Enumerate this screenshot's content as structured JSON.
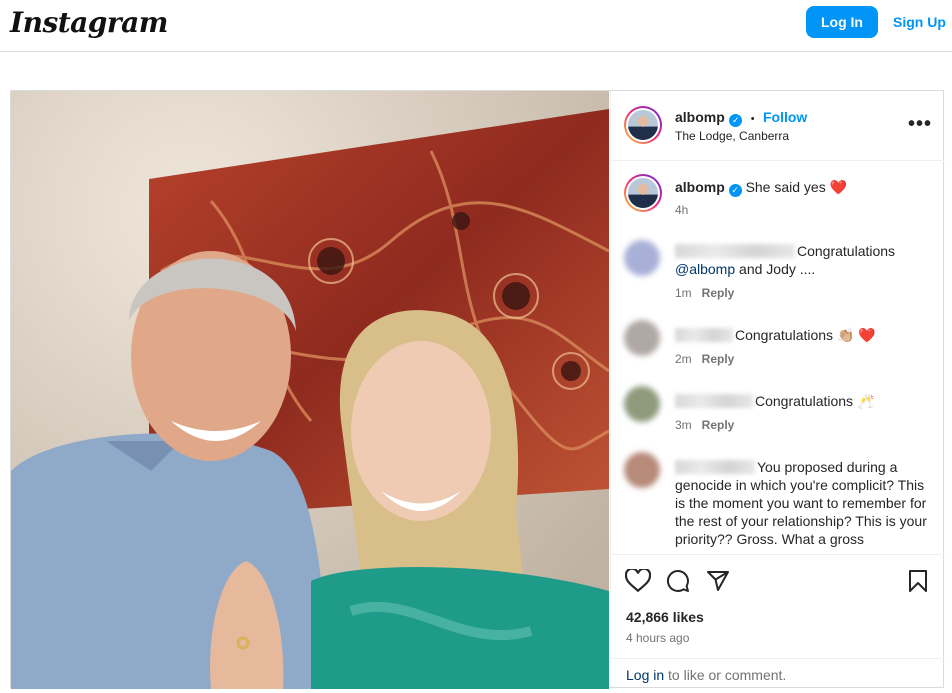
{
  "header": {
    "logo": "Instagram",
    "login_label": "Log In",
    "signup_label": "Sign Up"
  },
  "post": {
    "username": "albomp",
    "follow_label": "Follow",
    "separator": "•",
    "location": "The Lodge, Canberra",
    "more_label": "•••",
    "caption": {
      "username": "albomp",
      "text": "She said yes",
      "emoji": "❤️",
      "time": "4h"
    },
    "comments": [
      {
        "text": "Congratulations",
        "mention": "@albomp",
        "text_after": "and Jody ....",
        "time": "1m",
        "reply_label": "Reply"
      },
      {
        "text": "Congratulations 👏🏼 ❤️",
        "time": "2m",
        "reply_label": "Reply"
      },
      {
        "text": "Congratulations 🥂",
        "time": "3m",
        "reply_label": "Reply"
      },
      {
        "text": "You proposed during a genocide in which you're complicit? This is the moment you want to remember for the rest of your relationship? This is your priority?? Gross. What a gross"
      }
    ],
    "likes": "42,866 likes",
    "posted_ago": "4 hours ago",
    "login_prompt": {
      "link": "Log in",
      "text": "to like or comment."
    }
  },
  "icons": [
    "heart-icon",
    "comment-icon",
    "share-icon",
    "bookmark-icon",
    "verified-icon",
    "more-options-icon"
  ],
  "colors": {
    "accent": "#0095f6",
    "border": "#dbdbdb",
    "secondary_text": "#737373",
    "mention": "#00376b"
  }
}
